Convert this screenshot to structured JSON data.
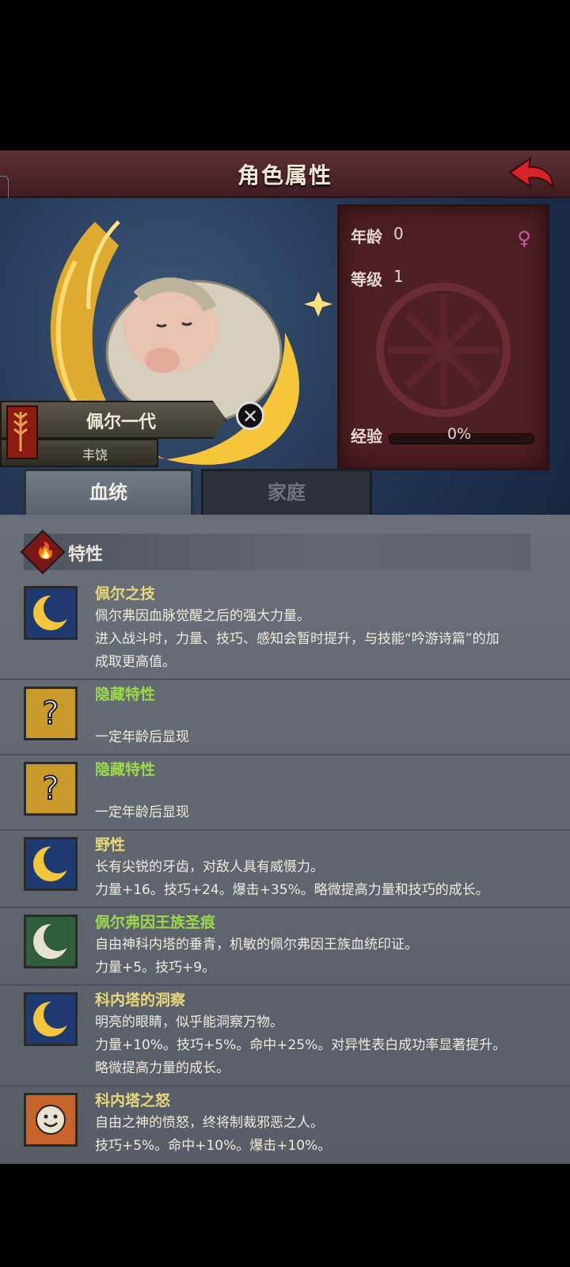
{
  "header": {
    "title": "角色属性"
  },
  "character": {
    "name": "佩尔一代",
    "title": "丰饶"
  },
  "stats": {
    "age_label": "年龄",
    "age_value": "0",
    "level_label": "等级",
    "level_value": "1",
    "exp_label": "经验",
    "exp_value": "0%",
    "exp_fraction": 0.0
  },
  "tabs": [
    {
      "label": "血统",
      "active": true
    },
    {
      "label": "家庭",
      "active": false
    }
  ],
  "section": {
    "title": "特性"
  },
  "traits": [
    {
      "name": "佩尔之技",
      "icon": "moon-icon",
      "lines": [
        "佩尔弗因血脉觉醒之后的强大力量。",
        "进入战斗时，力量、技巧、感知会暂时提升，与技能“吟游诗篇”的加",
        "成取更高值。"
      ]
    },
    {
      "name": "隐藏特性",
      "icon": "question-icon",
      "lines": [
        "",
        "一定年龄后显现"
      ]
    },
    {
      "name": "隐藏特性",
      "icon": "question-icon",
      "lines": [
        "",
        "一定年龄后显现"
      ]
    },
    {
      "name": "野性",
      "icon": "moon-icon",
      "lines": [
        "长有尖锐的牙齿，对敌人具有威慑力。",
        "力量+16。技巧+24。爆击+35%。略微提高力量和技巧的成长。"
      ]
    },
    {
      "name": "佩尔弗因王族圣痕",
      "icon": "silver-moon-icon",
      "lines": [
        "自由神科内塔的垂青，机敏的佩尔弗因王族血统印证。",
        "力量+5。技巧+9。"
      ]
    },
    {
      "name": "科内塔的洞察",
      "icon": "moon-icon",
      "lines": [
        "明亮的眼睛，似乎能洞察万物。",
        "力量+10%。技巧+5%。命中+25%。对异性表白成功率显著提升。",
        "略微提高力量的成长。"
      ]
    },
    {
      "name": "科内塔之怒",
      "icon": "smiley-sun-icon",
      "lines": [
        "自由之神的愤怒，终将制裁邪恶之人。",
        "技巧+5%。命中+10%。爆击+10%。"
      ]
    }
  ],
  "colors": {
    "header_bg": "#4e2529",
    "trait_name": "#9bd84a",
    "panel_bg": "#4e1f25",
    "content_bg": "#62686f"
  }
}
